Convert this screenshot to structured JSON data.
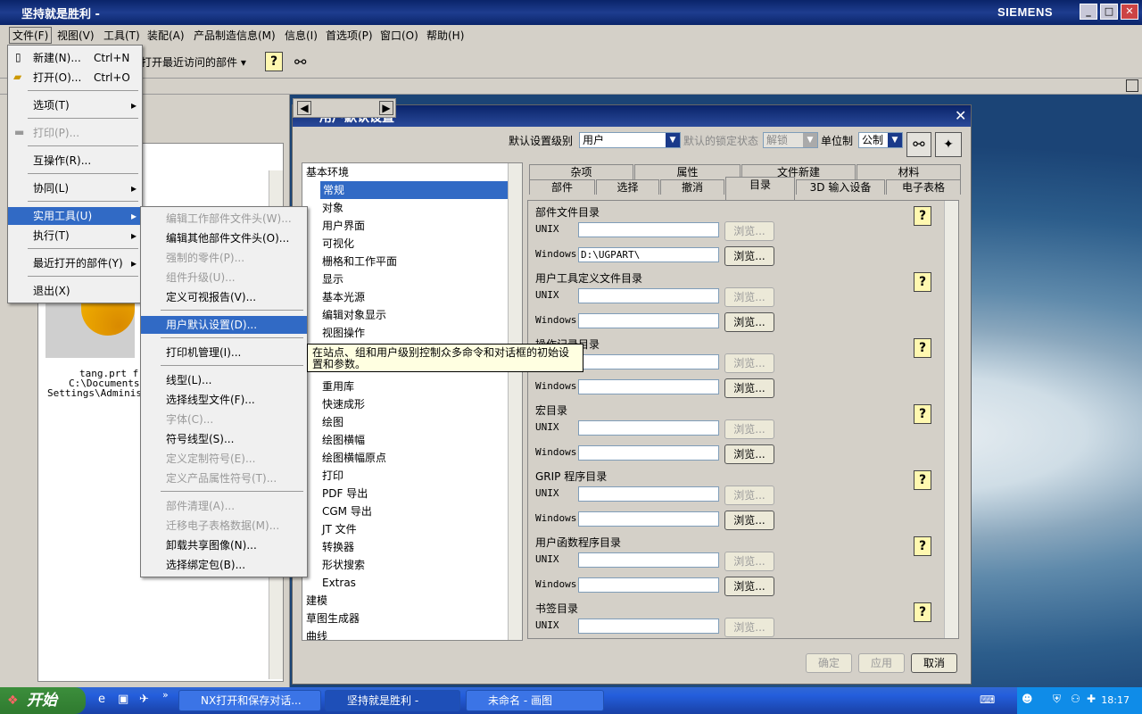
{
  "app": {
    "title": "坚持就是胜利 -",
    "brand": "SIEMENS"
  },
  "menubar": [
    "文件(F)",
    "视图(V)",
    "工具(T)",
    "装配(A)",
    "产品制造信息(M)",
    "信息(I)",
    "首选项(P)",
    "窗口(O)",
    "帮助(H)"
  ],
  "toolbar": {
    "recent": "打开最近访问的部件"
  },
  "file_menu": {
    "items": [
      {
        "label": "新建(N)...",
        "shortcut": "Ctrl+N"
      },
      {
        "label": "打开(O)...",
        "shortcut": "Ctrl+O"
      },
      {
        "label": "选项(T)"
      },
      {
        "label": "打印(P)..."
      },
      {
        "label": "互操作(R)..."
      },
      {
        "label": "协同(L)"
      },
      {
        "label": "实用工具(U)"
      },
      {
        "label": "执行(T)"
      },
      {
        "label": "最近打开的部件(Y)"
      },
      {
        "label": "退出(X)"
      }
    ]
  },
  "util_menu": {
    "items": [
      "编辑工作部件文件头(W)...",
      "编辑其他部件文件头(O)...",
      "强制的零件(P)...",
      "组件升级(U)...",
      "定义可视报告(V)...",
      "用户默认设置(D)...",
      "打印机管理(I)...",
      "线型(L)...",
      "选择线型文件(F)...",
      "字体(C)...",
      "符号线型(S)...",
      "定义定制符号(E)...",
      "定义产品属性符号(T)...",
      "部件清理(A)...",
      "迁移电子表格数据(M)...",
      "卸载共享图像(N)...",
      "选择绑定包(B)..."
    ]
  },
  "tooltip": "在站点、组和用户级别控制众多命令和对话框的初始设置和参数。",
  "leftpanel": {
    "file1": "tang.prt fro",
    "file2": "C:\\Documents",
    "file3": "Settings\\Administ"
  },
  "dialog": {
    "title": "用户默认设置",
    "level_label": "默认设置级别",
    "level_value": "用户",
    "lock_label": "默认的锁定状态",
    "lock_value": "解锁",
    "unit_label": "单位制",
    "unit_value": "公制",
    "tree": [
      "基本环境",
      "常规",
      "对象",
      "用户界面",
      "可视化",
      "栅格和工作平面",
      "显示",
      "基本光源",
      "编辑对象显示",
      "视图操作",
      "重用库",
      "快速成形",
      "绘图",
      "绘图横幅",
      "绘图横幅原点",
      "打印",
      "PDF 导出",
      "CGM 导出",
      "JT 文件",
      "转换器",
      "形状搜索",
      "Extras",
      "建模",
      "草图生成器",
      "曲线"
    ],
    "tabs_row1": [
      "杂项",
      "属性",
      "文件新建",
      "材料"
    ],
    "tabs_row2": [
      "部件",
      "选择",
      "撤消",
      "目录",
      "3D 输入设备",
      "电子表格"
    ],
    "sections": [
      {
        "title": "部件文件目录",
        "unix": "",
        "windows": "D:\\UGPART\\"
      },
      {
        "title": "用户工具定义文件目录",
        "unix": "",
        "windows": ""
      },
      {
        "title": "操作记录目录",
        "unix": "",
        "windows": ""
      },
      {
        "title": "宏目录",
        "unix": "",
        "windows": ""
      },
      {
        "title": "GRIP 程序目录",
        "unix": "",
        "windows": ""
      },
      {
        "title": "用户函数程序目录",
        "unix": "",
        "windows": ""
      },
      {
        "title": "书签目录",
        "unix": "",
        "windows": ""
      }
    ],
    "unix_label": "UNIX",
    "windows_label": "Windows",
    "browse": "浏览...",
    "ok": "确定",
    "apply": "应用",
    "cancel": "取消"
  },
  "taskbar": {
    "start": "开始",
    "tasks": [
      "NX打开和保存对话...",
      "坚持就是胜利 -",
      "未命名 - 画图"
    ],
    "clock": "18:17"
  }
}
